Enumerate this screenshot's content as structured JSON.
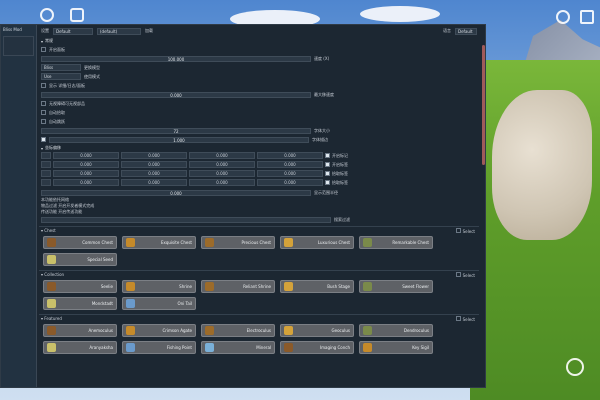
{
  "window": {
    "title": "Bliss Mod"
  },
  "top": {
    "label": "设置",
    "dropdown": "Default",
    "dropdown2": "(default)",
    "btn_label": "加载",
    "right_label": "语言",
    "right_dd": "Default"
  },
  "general": {
    "header": "常规",
    "rows": [
      {
        "label": "开启面板",
        "checked": false
      },
      {
        "bar": "100.000",
        "label": "速度 (X)"
      },
      {
        "dd": "Bliss",
        "label": "更换模型"
      },
      {
        "dd": "Use",
        "label": "使用模式"
      },
      {
        "label": "显示 详细/日志/面板",
        "checked": false
      },
      {
        "bar": "0.000",
        "label": "最大移速度"
      },
      {
        "label": "无视障碍可无视部品",
        "checked": false
      },
      {
        "label": "自动拾取",
        "checked": false
      },
      {
        "label": "自动跳跃",
        "checked": false
      },
      {
        "bar": "72",
        "label": "字体大小"
      },
      {
        "bar": "1.000",
        "label": "字体描边",
        "checked": true
      }
    ]
  },
  "coords": {
    "header": "坐标偏移",
    "rows": [
      {
        "vals": [
          "0.000",
          "0.000",
          "0.000",
          "0.000"
        ],
        "cb": "开启标记"
      },
      {
        "vals": [
          "0.000",
          "0.000",
          "0.000",
          "0.000"
        ],
        "cb": "开启标签"
      },
      {
        "vals": [
          "0.000",
          "0.000",
          "0.000",
          "0.000"
        ],
        "cb": "拾取标签"
      },
      {
        "vals": [
          "0.000",
          "0.000",
          "0.000",
          "0.000"
        ],
        "cb": "拾取标签"
      }
    ],
    "bar": "0.000",
    "bar_label": "显示范围半径"
  },
  "extra_lines": [
    "本功能依托网络",
    "物品过滤  开启开发者模式完成",
    "传送功能  开启传送功能"
  ],
  "search_label": "搜索过滤",
  "categories": [
    {
      "name": "Chest",
      "select": "Select",
      "items": [
        "Common Chest",
        "Exquisite Chest",
        "Precious Chest",
        "Luxurious Chest",
        "Remarkable Chest",
        "Special Seed"
      ]
    },
    {
      "name": "Collection",
      "select": "Select",
      "items": [
        "Seelie",
        "Shrine",
        "Reliant Shrine",
        "Bush Stage",
        "Sweet Flower",
        "Mondstadt",
        "Oni Tail"
      ]
    },
    {
      "name": "Featured",
      "select": "Select",
      "items": [
        "Anemoculus",
        "Crimson Agate",
        "Electroculus",
        "Geoculus",
        "Dendroculus",
        "Aranyaksha",
        "Fishing Point",
        "Mineral",
        "Imaging Conch",
        "Key Sigil"
      ]
    }
  ],
  "colors": {
    "panel": "#1c2732",
    "button": "#5e6166",
    "accent": "#e04848"
  }
}
